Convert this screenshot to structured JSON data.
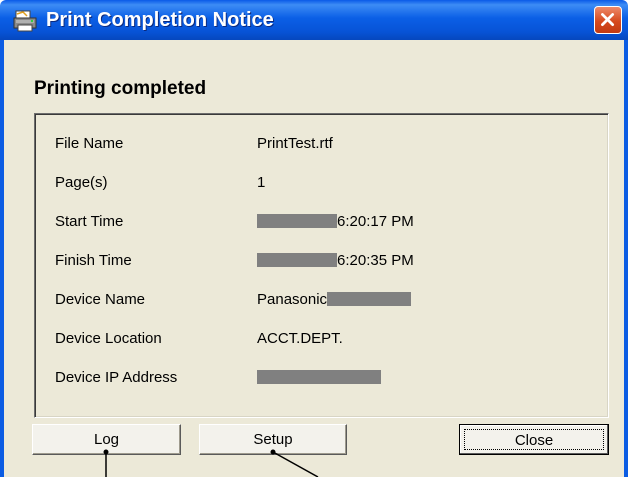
{
  "window": {
    "title": "Print Completion Notice",
    "close_icon": "close-x-icon",
    "app_icon": "printer-app-icon"
  },
  "heading": "Printing completed",
  "details": [
    {
      "label": "File Name",
      "value": "PrintTest.rtf",
      "redacted": false
    },
    {
      "label": "Page(s)",
      "value": "1",
      "redacted": false
    },
    {
      "label": "Start Time",
      "value": "6:20:17 PM",
      "redacted": "prefix"
    },
    {
      "label": "Finish Time",
      "value": "6:20:35 PM",
      "redacted": "prefix"
    },
    {
      "label": "Device Name",
      "value": "Panasonic",
      "redacted": "suffix"
    },
    {
      "label": "Device Location",
      "value": "ACCT.DEPT.",
      "redacted": false
    },
    {
      "label": "Device IP Address",
      "value": "",
      "redacted": "full"
    }
  ],
  "buttons": {
    "log": "Log",
    "setup": "Setup",
    "close": "Close"
  },
  "colors": {
    "titlebar": "#0b5fe6",
    "client": "#ece9d8",
    "close_button": "#d64a1e",
    "redaction": "#808080"
  }
}
